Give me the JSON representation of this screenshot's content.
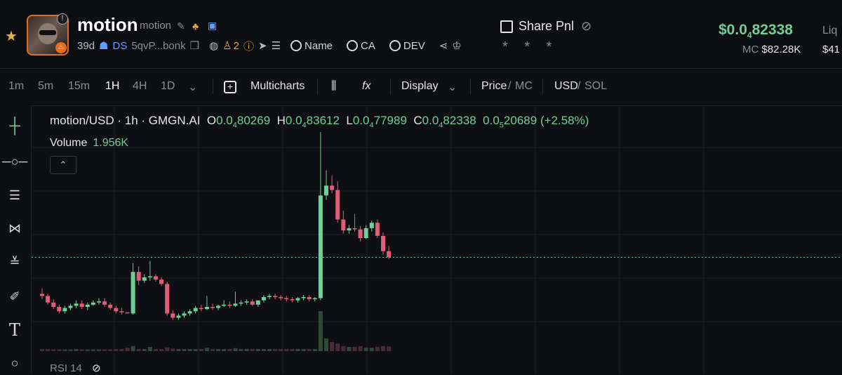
{
  "header": {
    "token_name": "motion",
    "token_symbol": "motion",
    "age": "39d",
    "ds_label": "DS",
    "address": "5qvP...bonk",
    "holders_count": "2",
    "search_name": "Name",
    "search_ca": "CA",
    "search_dev": "DEV",
    "share_label": "Share Pnl",
    "masked": "* * *",
    "price_prefix": "$0.0",
    "price_sub": "4",
    "price_rest": "82338",
    "mc_label": "MC",
    "mc_value": "$82.28K",
    "liq_label": "Liq",
    "liq_value": "$41"
  },
  "toolbar": {
    "intervals": [
      "1m",
      "5m",
      "15m",
      "1H",
      "4H",
      "1D"
    ],
    "active_interval": "1H",
    "multicharts": "Multicharts",
    "display": "Display",
    "price_label": "Price",
    "mc_label": "MC",
    "usd_label": "USD",
    "sol_label": "SOL"
  },
  "legend": {
    "pair": "motion/USD · 1h · GMGN.AI",
    "o_label": "O",
    "o_pre": "0.0",
    "o_sub": "4",
    "o_rest": "80269",
    "h_label": "H",
    "h_pre": "0.0",
    "h_sub": "4",
    "h_rest": "83612",
    "l_label": "L",
    "l_pre": "0.0",
    "l_sub": "4",
    "l_rest": "77989",
    "c_label": "C",
    "c_pre": "0.0",
    "c_sub": "4",
    "c_rest": "82338",
    "chg_pre": "0.0",
    "chg_sub": "5",
    "chg_rest": "20689",
    "chg_pct": "(+2.58%)",
    "volume_label": "Volume",
    "volume_value": "1.956K",
    "rsi_label": "RSI 14"
  },
  "chart_data": {
    "type": "candlestick",
    "last_price": 8.234e-05,
    "candles": [
      [
        7.9e-05,
        7.95e-05,
        7.85e-05,
        7.88e-05
      ],
      [
        7.88e-05,
        7.9e-05,
        7.8e-05,
        7.82e-05
      ],
      [
        7.82e-05,
        7.85e-05,
        7.76e-05,
        7.78e-05
      ],
      [
        7.78e-05,
        7.8e-05,
        7.72e-05,
        7.74e-05
      ],
      [
        7.74e-05,
        7.79e-05,
        7.72e-05,
        7.77e-05
      ],
      [
        7.77e-05,
        7.81e-05,
        7.75e-05,
        7.79e-05
      ],
      [
        7.79e-05,
        7.84e-05,
        7.77e-05,
        7.81e-05
      ],
      [
        7.81e-05,
        7.84e-05,
        7.76e-05,
        7.78e-05
      ],
      [
        7.78e-05,
        7.82e-05,
        7.75e-05,
        7.8e-05
      ],
      [
        7.8e-05,
        7.84e-05,
        7.79e-05,
        7.82e-05
      ],
      [
        7.82e-05,
        7.86e-05,
        7.8e-05,
        7.83e-05
      ],
      [
        7.83e-05,
        7.86e-05,
        7.78e-05,
        7.8e-05
      ],
      [
        7.8e-05,
        7.82e-05,
        7.75e-05,
        7.77e-05
      ],
      [
        7.77e-05,
        7.79e-05,
        7.72e-05,
        7.74e-05
      ],
      [
        7.74e-05,
        7.77e-05,
        7.71e-05,
        7.73e-05
      ],
      [
        7.73e-05,
        7.7e-05,
        7.7e-05,
        7.72e-05
      ],
      [
        7.72e-05,
        8.18e-05,
        7.71e-05,
        8.1e-05
      ],
      [
        8.1e-05,
        8.15e-05,
        7.98e-05,
        8.02e-05
      ],
      [
        8.02e-05,
        8.08e-05,
        8e-05,
        8.05e-05
      ],
      [
        8.05e-05,
        8.2e-05,
        8.02e-05,
        8.06e-05
      ],
      [
        8.06e-05,
        8.08e-05,
        8.01e-05,
        8.03e-05
      ],
      [
        8.03e-05,
        8.05e-05,
        7.97e-05,
        7.99e-05
      ],
      [
        7.99e-05,
        8.01e-05,
        7.7e-05,
        7.72e-05
      ],
      [
        7.72e-05,
        7.75e-05,
        7.66e-05,
        7.68e-05
      ],
      [
        7.68e-05,
        7.72e-05,
        7.66e-05,
        7.7e-05
      ],
      [
        7.7e-05,
        7.74e-05,
        7.68e-05,
        7.72e-05
      ],
      [
        7.72e-05,
        7.76e-05,
        7.7e-05,
        7.74e-05
      ],
      [
        7.74e-05,
        7.79e-05,
        7.72e-05,
        7.77e-05
      ],
      [
        7.77e-05,
        7.8e-05,
        7.74e-05,
        7.76e-05
      ],
      [
        7.76e-05,
        7.88e-05,
        7.75e-05,
        7.78e-05
      ],
      [
        7.78e-05,
        7.81e-05,
        7.75e-05,
        7.77e-05
      ],
      [
        7.77e-05,
        7.8e-05,
        7.75e-05,
        7.79e-05
      ],
      [
        7.79e-05,
        7.84e-05,
        7.78e-05,
        7.8e-05
      ],
      [
        7.8e-05,
        7.83e-05,
        7.77e-05,
        7.79e-05
      ],
      [
        7.79e-05,
        7.92e-05,
        7.78e-05,
        7.81e-05
      ],
      [
        7.81e-05,
        7.84e-05,
        7.79e-05,
        7.82e-05
      ],
      [
        7.82e-05,
        7.85e-05,
        7.8e-05,
        7.83e-05
      ],
      [
        7.83e-05,
        7.85e-05,
        7.79e-05,
        7.8e-05
      ],
      [
        7.8e-05,
        7.83e-05,
        7.78e-05,
        7.84e-05
      ],
      [
        7.84e-05,
        7.89e-05,
        7.82e-05,
        7.87e-05
      ],
      [
        7.87e-05,
        7.9e-05,
        7.85e-05,
        7.88e-05
      ],
      [
        7.88e-05,
        7.9e-05,
        7.85e-05,
        7.87e-05
      ],
      [
        7.87e-05,
        7.89e-05,
        7.84e-05,
        7.86e-05
      ],
      [
        7.86e-05,
        7.88e-05,
        7.83e-05,
        7.85e-05
      ],
      [
        7.85e-05,
        7.87e-05,
        7.82e-05,
        7.84e-05
      ],
      [
        7.84e-05,
        7.87e-05,
        7.82e-05,
        7.86e-05
      ],
      [
        7.86e-05,
        7.89e-05,
        7.84e-05,
        7.87e-05
      ],
      [
        7.87e-05,
        7.89e-05,
        7.83e-05,
        7.85e-05
      ],
      [
        7.85e-05,
        7.87e-05,
        7.83e-05,
        7.86e-05
      ],
      [
        7.86e-05,
        9.38e-05,
        7.84e-05,
        8.8e-05
      ],
      [
        8.8e-05,
        9.03e-05,
        8.76e-05,
        8.89e-05
      ],
      [
        8.89e-05,
        8.98e-05,
        8.82e-05,
        8.85e-05
      ],
      [
        8.85e-05,
        8.93e-05,
        8.55e-05,
        8.58e-05
      ],
      [
        8.58e-05,
        8.66e-05,
        8.45e-05,
        8.48e-05
      ],
      [
        8.48e-05,
        8.53e-05,
        8.45e-05,
        8.5e-05
      ],
      [
        8.5e-05,
        8.63e-05,
        8.47e-05,
        8.49e-05
      ],
      [
        8.49e-05,
        8.52e-05,
        8.38e-05,
        8.41e-05
      ],
      [
        8.41e-05,
        8.53e-05,
        8.4e-05,
        8.5e-05
      ],
      [
        8.5e-05,
        8.57e-05,
        8.47e-05,
        8.55e-05
      ],
      [
        8.55e-05,
        8.58e-05,
        8.41e-05,
        8.43e-05
      ],
      [
        8.43e-05,
        8.46e-05,
        8.26e-05,
        8.29e-05
      ],
      [
        8.29e-05,
        8.34e-05,
        8.22e-05,
        8.234e-05
      ]
    ],
    "volumes": [
      0.05,
      0.05,
      0.04,
      0.04,
      0.04,
      0.04,
      0.05,
      0.04,
      0.04,
      0.04,
      0.04,
      0.04,
      0.04,
      0.05,
      0.05,
      0.08,
      0.12,
      0.05,
      0.05,
      0.1,
      0.05,
      0.05,
      0.09,
      0.06,
      0.05,
      0.05,
      0.05,
      0.05,
      0.05,
      0.08,
      0.05,
      0.05,
      0.05,
      0.05,
      0.07,
      0.05,
      0.05,
      0.05,
      0.05,
      0.05,
      0.05,
      0.05,
      0.05,
      0.05,
      0.05,
      0.05,
      0.05,
      0.05,
      0.05,
      0.95,
      0.3,
      0.22,
      0.18,
      0.12,
      0.1,
      0.1,
      0.12,
      0.08,
      0.08,
      0.1,
      0.12,
      0.11
    ],
    "colors": {
      "up": "#6fcf97",
      "down": "#e05d77",
      "price_line": "#6fcf97"
    },
    "grid": true
  }
}
